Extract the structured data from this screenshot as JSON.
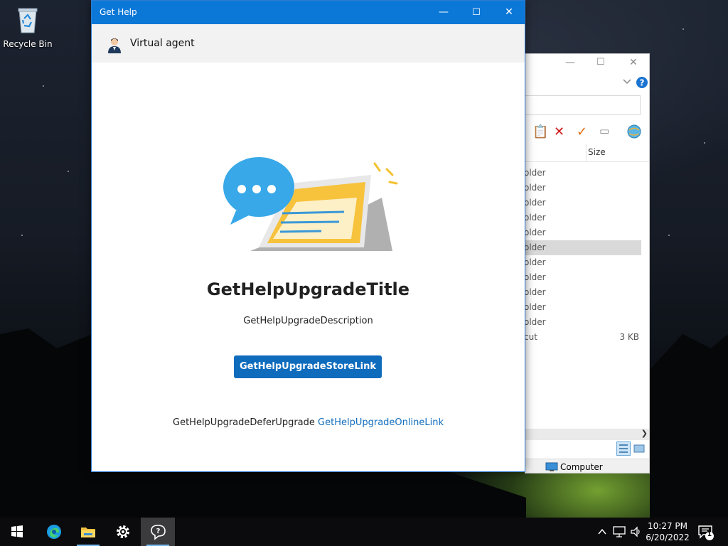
{
  "desktop": {
    "recycle_bin_label": "Recycle Bin"
  },
  "explorer": {
    "column_size": "Size",
    "rows": [
      {
        "name": "older",
        "size": ""
      },
      {
        "name": "older",
        "size": ""
      },
      {
        "name": "older",
        "size": ""
      },
      {
        "name": "older",
        "size": ""
      },
      {
        "name": "older",
        "size": ""
      },
      {
        "name": "older",
        "size": "",
        "selected": true
      },
      {
        "name": "older",
        "size": ""
      },
      {
        "name": "older",
        "size": ""
      },
      {
        "name": "older",
        "size": ""
      },
      {
        "name": "older",
        "size": ""
      },
      {
        "name": "older",
        "size": ""
      },
      {
        "name": "cut",
        "size": "3 KB"
      }
    ],
    "status_location": "Computer"
  },
  "gethelp": {
    "window_title": "Get Help",
    "agent_label": "Virtual agent",
    "heading": "GetHelpUpgradeTitle",
    "description": "GetHelpUpgradeDescription",
    "store_button": "GetHelpUpgradeStoreLink",
    "defer_text": "GetHelpUpgradeDeferUpgrade",
    "online_link": "GetHelpUpgradeOnlineLink",
    "accent_color": "#0b78d7"
  },
  "taskbar": {
    "apps": [
      "start-icon",
      "edge-icon",
      "file-explorer-icon",
      "settings-icon",
      "get-help-icon"
    ],
    "time": "10:27 PM",
    "date": "6/20/2022",
    "notification_count": "1"
  }
}
